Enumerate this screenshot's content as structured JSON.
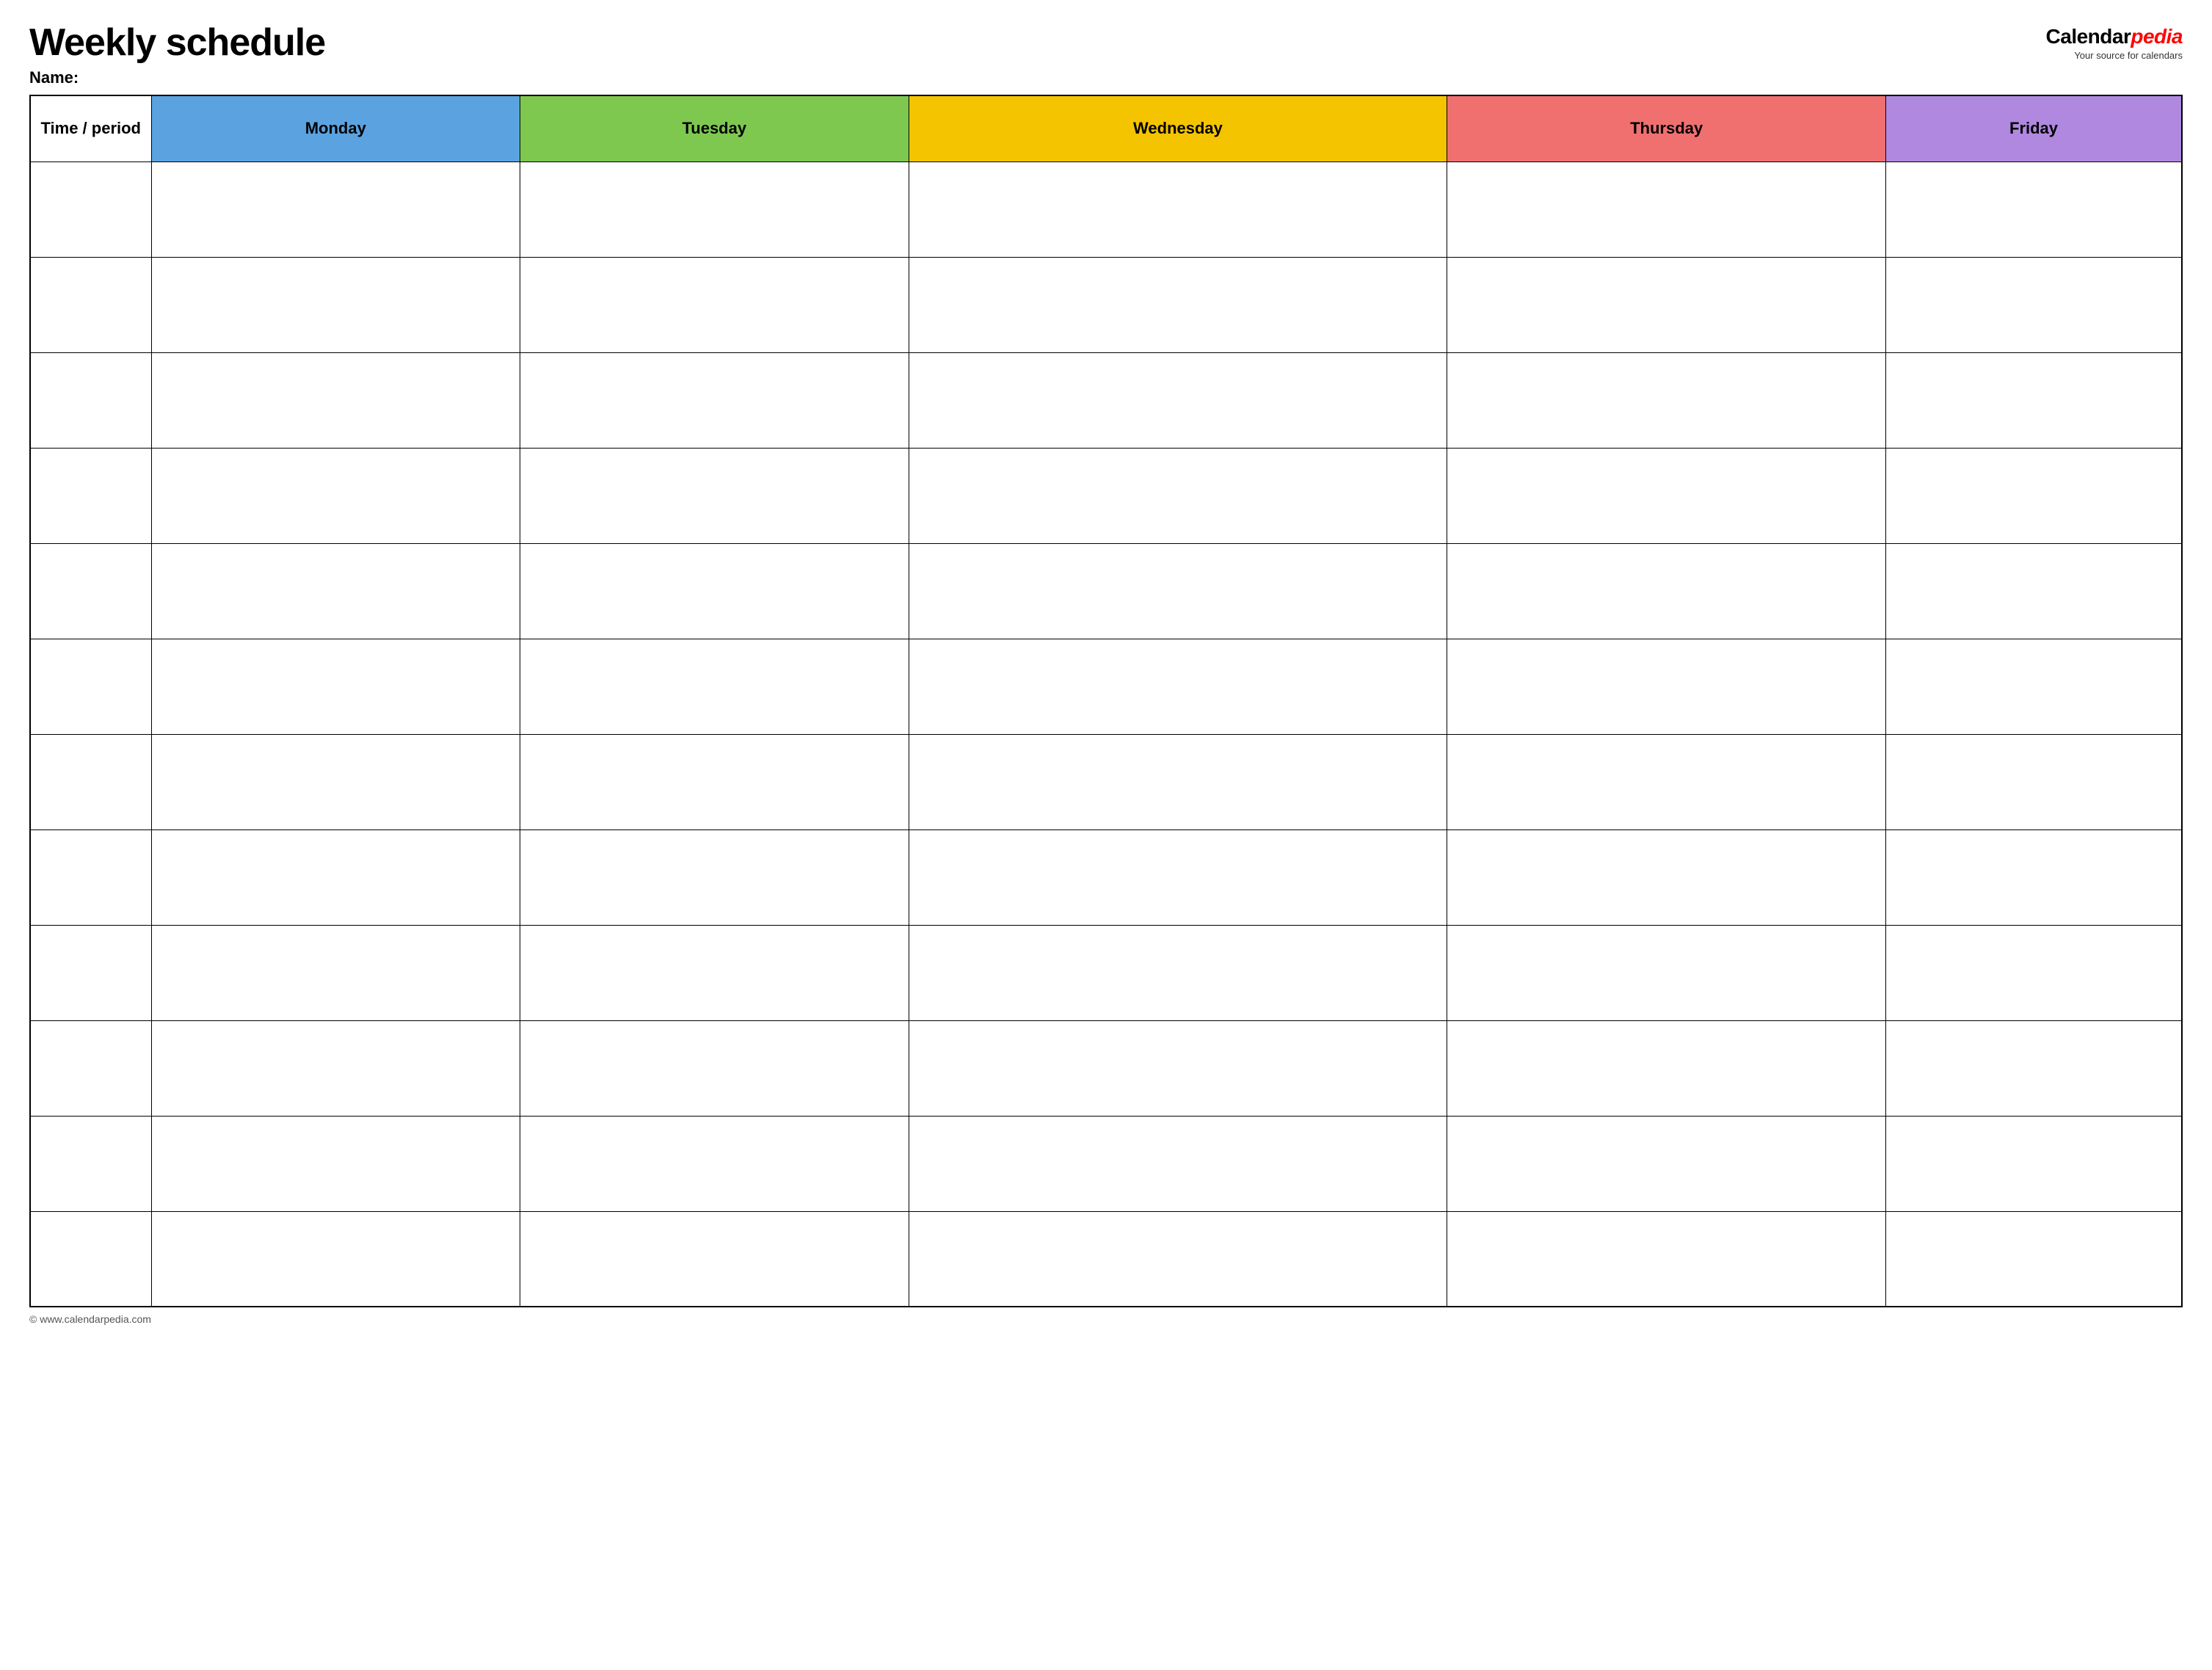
{
  "header": {
    "title": "Weekly schedule",
    "name_label": "Name:",
    "logo": {
      "text_calendar": "Calendar",
      "text_pedia": "pedia",
      "subtitle": "Your source for calendars"
    }
  },
  "table": {
    "columns": [
      {
        "id": "time",
        "label": "Time / period",
        "color": "#ffffff"
      },
      {
        "id": "monday",
        "label": "Monday",
        "color": "#5ba3e0"
      },
      {
        "id": "tuesday",
        "label": "Tuesday",
        "color": "#7ec850"
      },
      {
        "id": "wednesday",
        "label": "Wednesday",
        "color": "#f5c400"
      },
      {
        "id": "thursday",
        "label": "Thursday",
        "color": "#f07070"
      },
      {
        "id": "friday",
        "label": "Friday",
        "color": "#b088e0"
      }
    ],
    "row_count": 12
  },
  "footer": {
    "url": "© www.calendarpedia.com"
  }
}
